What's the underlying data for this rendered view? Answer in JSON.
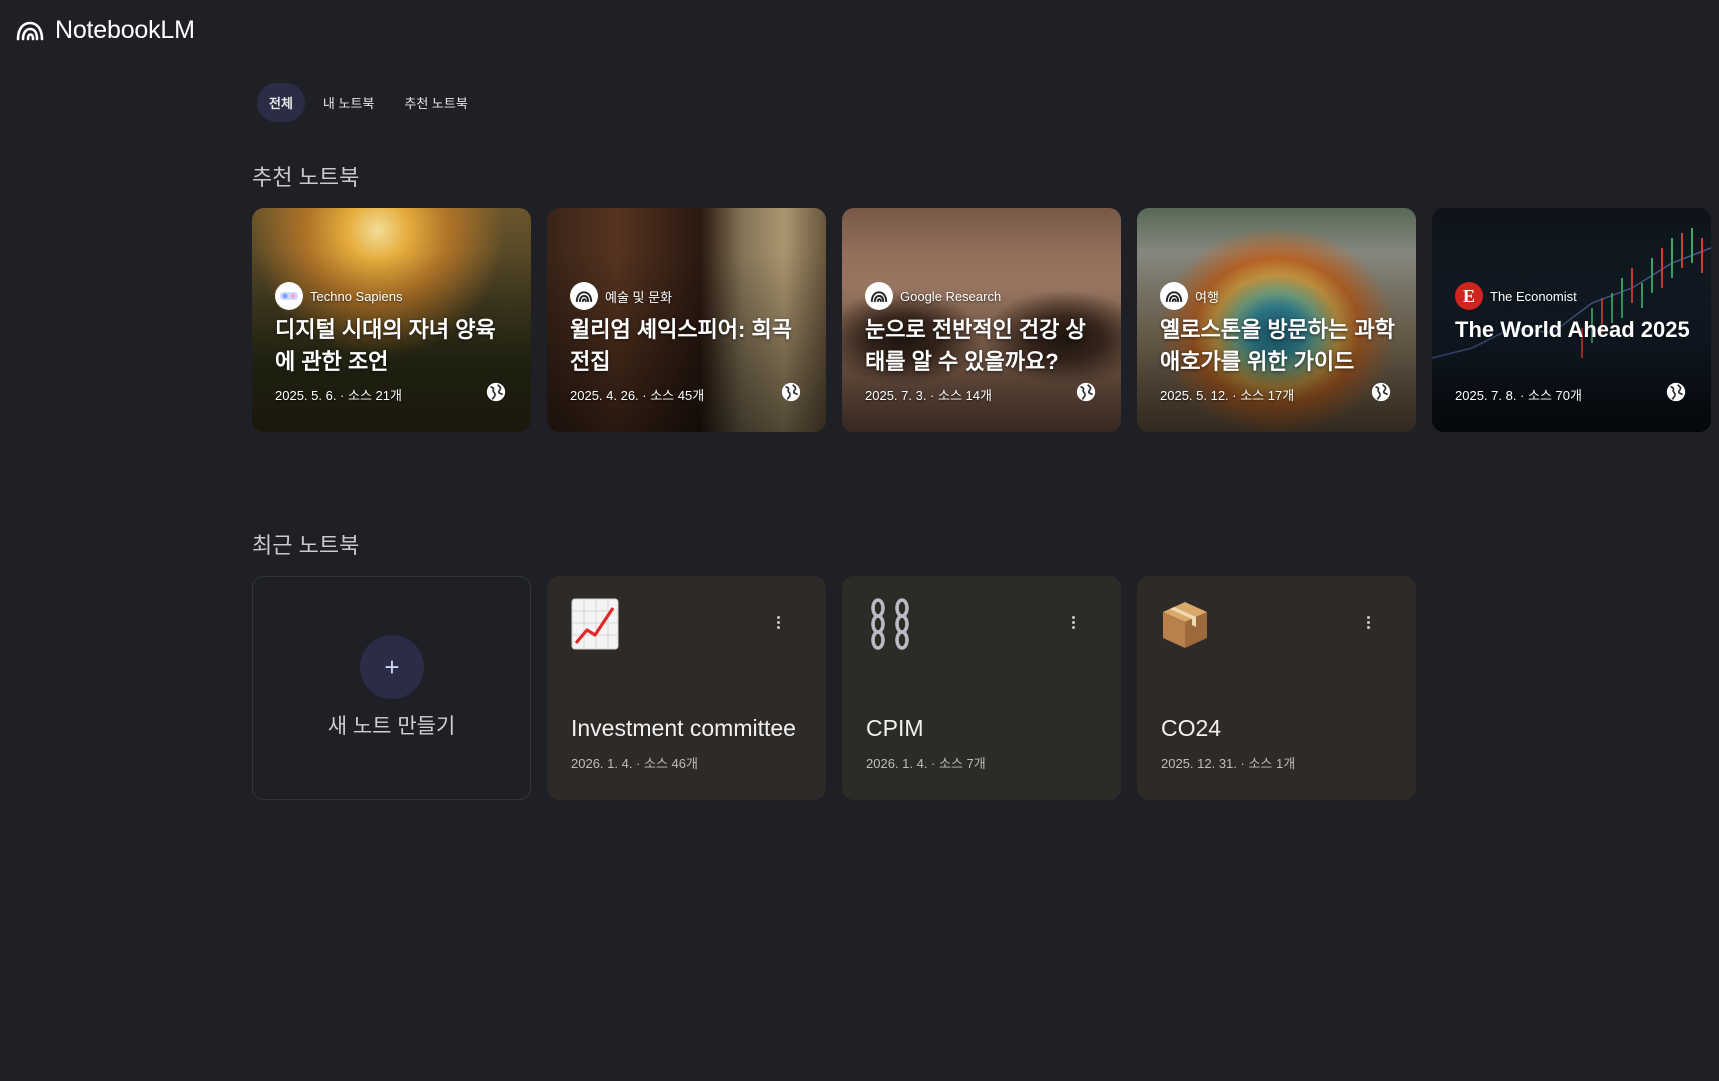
{
  "app": {
    "name": "NotebookLM",
    "logo_icon": "notebooklm-logo-icon"
  },
  "tabs": [
    {
      "label": "전체",
      "active": true
    },
    {
      "label": "내 노트북",
      "active": false
    },
    {
      "label": "추천 노트북",
      "active": false
    }
  ],
  "featured": {
    "title": "추천 노트북",
    "cards": [
      {
        "source": "Techno Sapiens",
        "title": "디지털 시대의 자녀 양육에 관한 조언",
        "meta": "2025. 5. 6. · 소스 21개",
        "source_icon": "techno-sapiens-icon",
        "public_icon": "globe-icon"
      },
      {
        "source": "예술 및 문화",
        "title": "윌리엄 셰익스피어: 희곡 전집",
        "meta": "2025. 4. 26. · 소스 45개",
        "source_icon": "notebooklm-icon",
        "public_icon": "globe-icon"
      },
      {
        "source": "Google Research",
        "title": "눈으로 전반적인 건강 상태를 알 수 있을까요?",
        "meta": "2025. 7. 3. · 소스 14개",
        "source_icon": "notebooklm-icon",
        "public_icon": "globe-icon"
      },
      {
        "source": "여행",
        "title": "옐로스톤을 방문하는 과학 애호가를 위한 가이드",
        "meta": "2025. 5. 12. · 소스 17개",
        "source_icon": "notebooklm-icon",
        "public_icon": "globe-icon"
      },
      {
        "source": "The Economist",
        "title": "The World Ahead 2025",
        "meta": "2025. 7. 8. · 소스 70개",
        "source_icon": "economist-icon",
        "public_icon": "globe-icon"
      }
    ]
  },
  "recent": {
    "title": "최근 노트북",
    "create_label": "새 노트 만들기",
    "create_icon": "plus-icon",
    "cards": [
      {
        "emoji": "chart-increasing-icon",
        "title": "Investment committee",
        "meta": "2026. 1. 4. · 소스 46개",
        "color": "#2e2a28"
      },
      {
        "emoji": "chains-icon",
        "title": "CPIM",
        "meta": "2026. 1. 4. · 소스 7개",
        "color": "#2c2b26"
      },
      {
        "emoji": "package-icon",
        "title": "CO24",
        "meta": "2025. 12. 31. · 소스 1개",
        "color": "#2e2a28"
      }
    ]
  }
}
